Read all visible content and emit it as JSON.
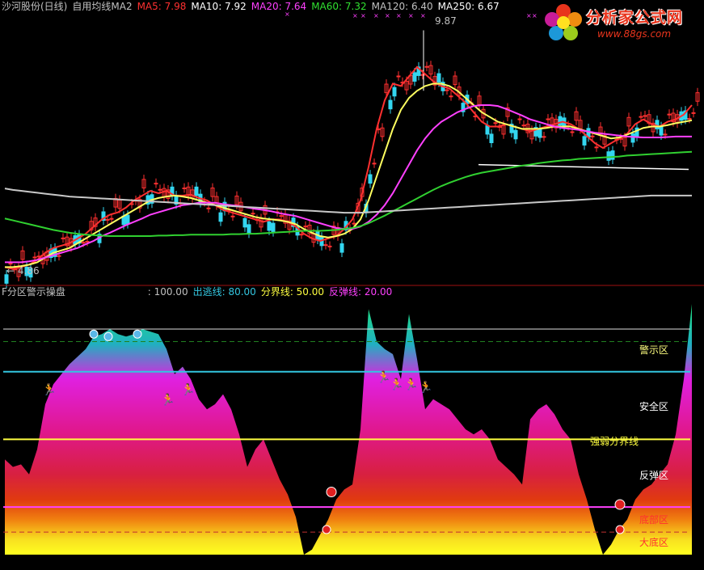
{
  "header": {
    "stock": "沙河股份(日线)",
    "indicator": "自用均线MA2",
    "ma": [
      {
        "label": "MA5: 7.98",
        "color": "#ff3030"
      },
      {
        "label": "MA10: 7.92",
        "color": "#ffffff"
      },
      {
        "label": "MA20: 7.64",
        "color": "#ff40ff"
      },
      {
        "label": "MA60: 7.32",
        "color": "#30e030"
      },
      {
        "label": "MA120: 6.40",
        "color": "#c0c0c0"
      },
      {
        "label": "MA250: 6.67",
        "color": "#ffffff"
      }
    ]
  },
  "logo": {
    "title": "分析家公式网",
    "url": "www.88gs.com"
  },
  "price_annotations": {
    "high": "9.87",
    "low": "← 4.86"
  },
  "lower_header": {
    "name": "F分区警示操盘",
    "value": ": 100.00",
    "lines": [
      {
        "label": "出逃线: 80.00",
        "color": "#33c6e0"
      },
      {
        "label": "分界线: 50.00",
        "color": "#ffff40"
      },
      {
        "label": "反弹线: 20.00",
        "color": "#ff40ff"
      }
    ]
  },
  "zones": {
    "warning": "警示区",
    "safe": "安全区",
    "divide": "强弱分界线",
    "rebound": "反弹区",
    "bottom": "底部区",
    "big_bottom": "大底区"
  },
  "colors": {
    "up": "#ff3030",
    "down": "#33d6f0",
    "ma5": "#ff3030",
    "ma10": "#ffff60",
    "ma20": "#ff40ff",
    "ma60": "#30d030",
    "ma120": "#c8c8c8",
    "ma250": "#ffffff"
  },
  "chart_data": [
    {
      "type": "line",
      "title": "沙河股份(日线) 自用均线MA2",
      "description_series": [
        "MA5",
        "MA10",
        "MA20",
        "MA60",
        "MA120",
        "MA250"
      ],
      "y_range": [
        4.6,
        10.2
      ],
      "annotations": {
        "max": 9.87,
        "min": 4.86
      },
      "x": [
        0,
        10,
        20,
        30,
        40,
        50,
        60,
        70,
        80,
        90,
        100,
        110,
        120,
        130,
        140,
        150,
        160,
        170,
        180,
        190,
        200,
        210,
        220,
        230,
        240,
        250,
        260,
        270,
        280,
        290,
        300,
        310,
        320,
        330,
        340,
        350,
        360,
        370,
        380,
        390,
        400,
        410,
        420,
        430,
        440,
        450,
        460,
        470,
        480,
        490,
        500,
        510,
        520,
        530,
        540,
        550,
        560,
        570,
        580,
        590,
        600,
        610,
        620,
        630,
        640,
        650,
        660,
        670,
        680,
        690,
        700,
        710,
        720,
        730,
        740,
        750,
        760,
        770,
        780,
        790,
        800,
        810,
        820,
        830,
        840,
        850
      ],
      "series": [
        {
          "name": "MA5",
          "values": [
            4.9,
            4.86,
            4.9,
            4.95,
            5.05,
            5.2,
            5.3,
            5.35,
            5.4,
            5.5,
            5.6,
            5.75,
            5.9,
            6.0,
            6.05,
            6.15,
            6.3,
            6.4,
            6.5,
            6.45,
            6.5,
            6.4,
            6.4,
            6.42,
            6.35,
            6.3,
            6.2,
            6.1,
            6.05,
            6.0,
            5.95,
            5.9,
            5.85,
            5.9,
            5.9,
            5.85,
            5.75,
            5.6,
            5.5,
            5.45,
            5.5,
            5.55,
            5.7,
            5.9,
            6.3,
            7.0,
            7.8,
            8.4,
            8.75,
            8.7,
            8.9,
            9.1,
            8.95,
            8.8,
            8.7,
            8.65,
            8.5,
            8.35,
            8.15,
            7.95,
            7.85,
            7.85,
            7.9,
            7.85,
            7.8,
            7.75,
            7.8,
            7.85,
            7.9,
            7.95,
            7.9,
            7.8,
            7.65,
            7.5,
            7.4,
            7.5,
            7.6,
            7.7,
            7.9,
            8.0,
            7.9,
            7.85,
            7.95,
            8.0,
            8.1,
            8.3
          ]
        },
        {
          "name": "MA10",
          "values": [
            4.9,
            4.9,
            4.92,
            4.95,
            5.0,
            5.1,
            5.2,
            5.25,
            5.3,
            5.4,
            5.5,
            5.6,
            5.7,
            5.8,
            5.9,
            6.0,
            6.1,
            6.2,
            6.3,
            6.35,
            6.38,
            6.4,
            6.38,
            6.35,
            6.3,
            6.25,
            6.2,
            6.15,
            6.1,
            6.05,
            6.0,
            5.95,
            5.92,
            5.9,
            5.88,
            5.85,
            5.8,
            5.7,
            5.62,
            5.55,
            5.52,
            5.55,
            5.6,
            5.7,
            5.9,
            6.3,
            6.8,
            7.3,
            7.8,
            8.2,
            8.45,
            8.6,
            8.7,
            8.75,
            8.75,
            8.7,
            8.6,
            8.45,
            8.3,
            8.15,
            8.05,
            7.95,
            7.9,
            7.85,
            7.8,
            7.8,
            7.8,
            7.82,
            7.85,
            7.85,
            7.85,
            7.8,
            7.75,
            7.7,
            7.65,
            7.6,
            7.62,
            7.68,
            7.75,
            7.82,
            7.85,
            7.85,
            7.88,
            7.92,
            7.95,
            7.98
          ]
        },
        {
          "name": "MA20",
          "values": [
            5.0,
            5.0,
            5.0,
            5.02,
            5.05,
            5.1,
            5.15,
            5.2,
            5.25,
            5.3,
            5.38,
            5.45,
            5.55,
            5.62,
            5.7,
            5.78,
            5.85,
            5.92,
            6.0,
            6.05,
            6.1,
            6.15,
            6.2,
            6.22,
            6.25,
            6.25,
            6.25,
            6.22,
            6.2,
            6.18,
            6.15,
            6.12,
            6.1,
            6.07,
            6.03,
            6.0,
            5.97,
            5.92,
            5.87,
            5.82,
            5.77,
            5.72,
            5.7,
            5.7,
            5.75,
            5.85,
            6.0,
            6.2,
            6.45,
            6.75,
            7.05,
            7.35,
            7.6,
            7.8,
            7.95,
            8.05,
            8.15,
            8.22,
            8.28,
            8.3,
            8.3,
            8.28,
            8.22,
            8.15,
            8.08,
            8.0,
            7.95,
            7.9,
            7.85,
            7.82,
            7.8,
            7.78,
            7.75,
            7.72,
            7.7,
            7.68,
            7.66,
            7.64,
            7.63,
            7.62,
            7.62,
            7.62,
            7.63,
            7.64,
            7.64,
            7.64
          ]
        },
        {
          "name": "MA60",
          "values": [
            5.92,
            5.88,
            5.84,
            5.8,
            5.76,
            5.72,
            5.68,
            5.65,
            5.62,
            5.6,
            5.58,
            5.57,
            5.56,
            5.55,
            5.55,
            5.55,
            5.55,
            5.55,
            5.55,
            5.56,
            5.56,
            5.57,
            5.57,
            5.58,
            5.58,
            5.58,
            5.58,
            5.58,
            5.59,
            5.59,
            5.6,
            5.6,
            5.61,
            5.62,
            5.63,
            5.64,
            5.65,
            5.66,
            5.66,
            5.66,
            5.67,
            5.68,
            5.7,
            5.72,
            5.76,
            5.82,
            5.9,
            5.98,
            6.07,
            6.16,
            6.25,
            6.34,
            6.43,
            6.52,
            6.6,
            6.67,
            6.73,
            6.79,
            6.84,
            6.88,
            6.91,
            6.94,
            6.97,
            7.0,
            7.03,
            7.05,
            7.08,
            7.1,
            7.12,
            7.14,
            7.15,
            7.17,
            7.18,
            7.19,
            7.2,
            7.21,
            7.22,
            7.24,
            7.25,
            7.26,
            7.27,
            7.28,
            7.29,
            7.3,
            7.31,
            7.32
          ]
        },
        {
          "name": "MA120",
          "values": [
            6.55,
            6.52,
            6.5,
            6.48,
            6.46,
            6.44,
            6.42,
            6.4,
            6.38,
            6.37,
            6.36,
            6.35,
            6.34,
            6.33,
            6.32,
            6.31,
            6.3,
            6.29,
            6.28,
            6.27,
            6.26,
            6.25,
            6.24,
            6.23,
            6.22,
            6.21,
            6.2,
            6.19,
            6.18,
            6.17,
            6.16,
            6.15,
            6.14,
            6.13,
            6.12,
            6.11,
            6.1,
            6.09,
            6.08,
            6.07,
            6.06,
            6.05,
            6.04,
            6.04,
            6.04,
            6.05,
            6.06,
            6.07,
            6.08,
            6.09,
            6.1,
            6.11,
            6.12,
            6.13,
            6.14,
            6.15,
            6.16,
            6.17,
            6.18,
            6.19,
            6.2,
            6.21,
            6.22,
            6.23,
            6.24,
            6.25,
            6.26,
            6.27,
            6.28,
            6.29,
            6.3,
            6.31,
            6.32,
            6.33,
            6.34,
            6.35,
            6.36,
            6.37,
            6.38,
            6.39,
            6.4,
            6.4,
            6.4,
            6.4,
            6.4,
            6.4
          ]
        }
      ]
    },
    {
      "type": "area",
      "title": "F分区警示操盘",
      "y_range": [
        0,
        100
      ],
      "levels": {
        "出逃线": 80,
        "分界线": 50,
        "反弹线": 20
      },
      "x": [
        0,
        10,
        20,
        30,
        40,
        50,
        60,
        70,
        80,
        90,
        100,
        110,
        120,
        130,
        140,
        150,
        160,
        170,
        180,
        190,
        200,
        210,
        220,
        230,
        240,
        250,
        260,
        270,
        280,
        290,
        300,
        310,
        320,
        330,
        340,
        350,
        360,
        370,
        380,
        390,
        400,
        410,
        420,
        430,
        440,
        450,
        460,
        470,
        480,
        490,
        500,
        510,
        520,
        530,
        540,
        550,
        560,
        570,
        580,
        590,
        600,
        610,
        620,
        630,
        640,
        650,
        660,
        670,
        680,
        690,
        700,
        710,
        720,
        730,
        740,
        750,
        760,
        770,
        780,
        790,
        800,
        810,
        820,
        830,
        840,
        850
      ],
      "values": [
        38,
        35,
        36,
        32,
        42,
        60,
        68,
        72,
        76,
        79,
        82,
        87,
        88,
        90,
        88,
        87,
        88,
        90,
        89,
        88,
        82,
        72,
        75,
        70,
        62,
        58,
        60,
        64,
        58,
        48,
        35,
        42,
        46,
        38,
        30,
        24,
        15,
        0,
        2,
        8,
        14,
        22,
        26,
        28,
        50,
        98,
        85,
        82,
        80,
        70,
        96,
        78,
        58,
        62,
        60,
        58,
        54,
        50,
        48,
        50,
        46,
        38,
        35,
        32,
        28,
        54,
        58,
        60,
        56,
        50,
        46,
        32,
        22,
        10,
        0,
        4,
        10,
        14,
        22,
        26,
        28,
        32,
        36,
        48,
        70,
        100
      ]
    }
  ]
}
